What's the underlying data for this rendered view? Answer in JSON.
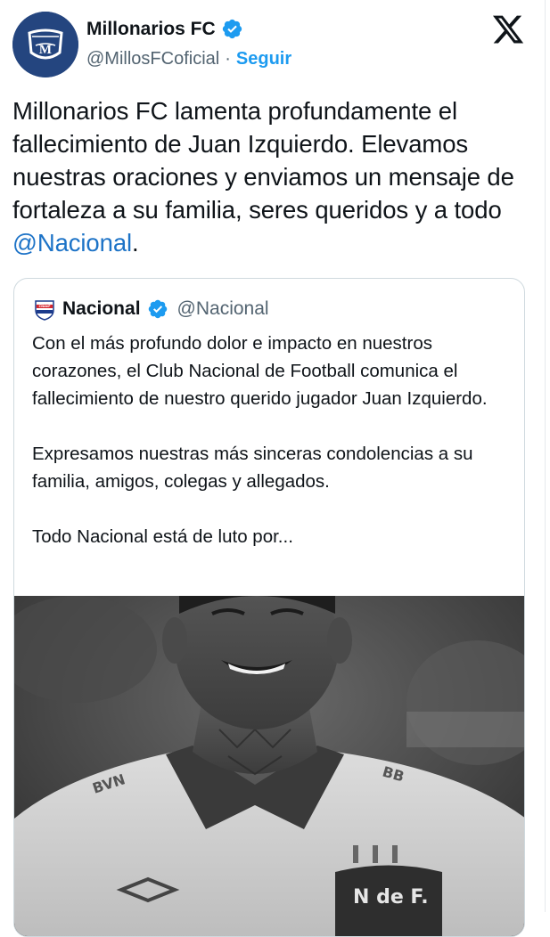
{
  "author": {
    "display_name": "Millonarios FC",
    "handle": "@MillosFCoficial",
    "separator": "·",
    "follow_label": "Seguir",
    "avatar_letter": "M"
  },
  "tweet": {
    "text_before": "Millonarios FC lamenta profundamente el fallecimiento de Juan Izquierdo. Elevamos nuestras oraciones y enviamos un mensaje de fortaleza a su familia, seres queridos y a todo ",
    "mention": "@Nacional",
    "text_after": "."
  },
  "quote": {
    "display_name": "Nacional",
    "handle": "@Nacional",
    "crest_text": "CNdeF",
    "paragraphs": [
      "Con el más profundo dolor e impacto en nuestros corazones, el Club Nacional de Football comunica el fallecimiento de nuestro querido jugador Juan Izquierdo.",
      "Expresamos nuestras más sinceras condolencias a su familia, amigos, colegas y allegados.",
      "Todo Nacional está de luto por..."
    ],
    "image_alt_text": "N de F."
  },
  "icons": {
    "verified": "verified-badge-icon",
    "x_logo": "x-logo-icon"
  },
  "colors": {
    "link": "#1d9bf0",
    "mention": "#1d73c7",
    "verified": "#1d9bf0",
    "millonarios_blue": "#24457f"
  }
}
